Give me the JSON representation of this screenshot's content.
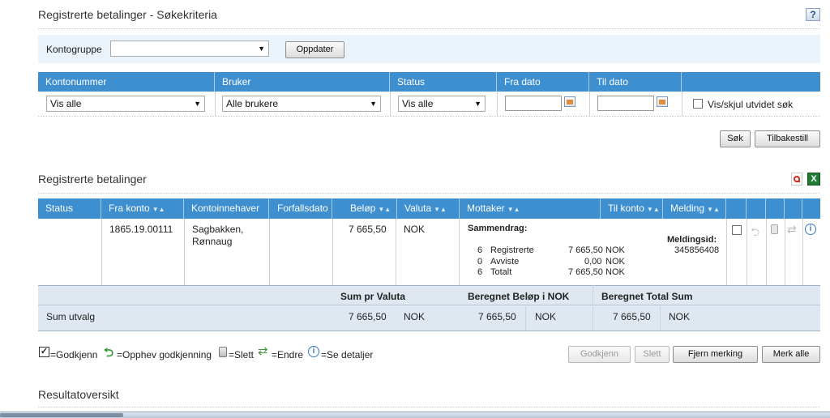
{
  "search": {
    "title": "Registrerte betalinger -  Søkekriteria",
    "help_label": "?",
    "kontogruppe_label": "Kontogruppe",
    "kontogruppe_value": "",
    "oppdater_label": "Oppdater",
    "filter_headers": [
      "Kontonummer",
      "Bruker",
      "Status",
      "Fra dato",
      "Til dato"
    ],
    "kontonummer_value": "Vis alle",
    "bruker_value": "Alle brukere",
    "status_value": "Vis alle",
    "fra_dato_value": "",
    "til_dato_value": "",
    "utvidet_label": "Vis/skjul utvidet søk",
    "sok_label": "Søk",
    "tilbakestill_label": "Tilbakestill"
  },
  "results": {
    "title": "Registrerte betalinger",
    "columns": {
      "status": "Status",
      "fra_konto": "Fra konto",
      "kontoinnehaver": "Kontoinnehaver",
      "forfallsdato": "Forfallsdato",
      "belop": "Beløp",
      "valuta": "Valuta",
      "mottaker": "Mottaker",
      "til_konto": "Til konto",
      "melding": "Melding"
    },
    "row": {
      "status": "",
      "fra_konto": "1865.19.00111",
      "kontoinnehaver_line1": "Sagbakken,",
      "kontoinnehaver_line2": "Rønnaug",
      "forfallsdato": "",
      "belop": "7 665,50",
      "valuta": "NOK",
      "summary_title": "Sammendrag:",
      "summary_rows": [
        {
          "count": "6",
          "label": "Registrerte",
          "amount": "7 665,50",
          "currency": "NOK"
        },
        {
          "count": "0",
          "label": "Avviste",
          "amount": "0,00",
          "currency": "NOK"
        },
        {
          "count": "6",
          "label": "Totalt",
          "amount": "7 665,50",
          "currency": "NOK"
        }
      ],
      "meldingsid_label": "Meldingsid:",
      "meldingsid_value": "345856408"
    },
    "sum_headers": {
      "sum_pr_valuta": "Sum pr Valuta",
      "beregnet_belop": "Beregnet Beløp i NOK",
      "beregnet_total": "Beregnet Total Sum"
    },
    "sum_utvalg": {
      "label": "Sum utvalg",
      "sum_amount": "7 665,50",
      "sum_currency": "NOK",
      "beregnet_amount": "7 665,50",
      "beregnet_currency": "NOK",
      "total_amount": "7 665,50",
      "total_currency": "NOK"
    }
  },
  "legend": {
    "godkjenn": "=Godkjenn",
    "opphev": "=Opphev godkjenning",
    "slett": "=Slett",
    "endre": "=Endre",
    "detaljer": "=Se detaljer"
  },
  "actions": {
    "godkjenn": "Godkjenn",
    "slett": "Slett",
    "fjern_merking": "Fjern merking",
    "merk_alle": "Merk alle"
  },
  "resultatoversikt": {
    "title": "Resultatoversikt"
  },
  "colors": {
    "header_blue": "#3d8fd0",
    "panel_light": "#eaf2fa",
    "sum_panel": "#dfe8f1"
  }
}
